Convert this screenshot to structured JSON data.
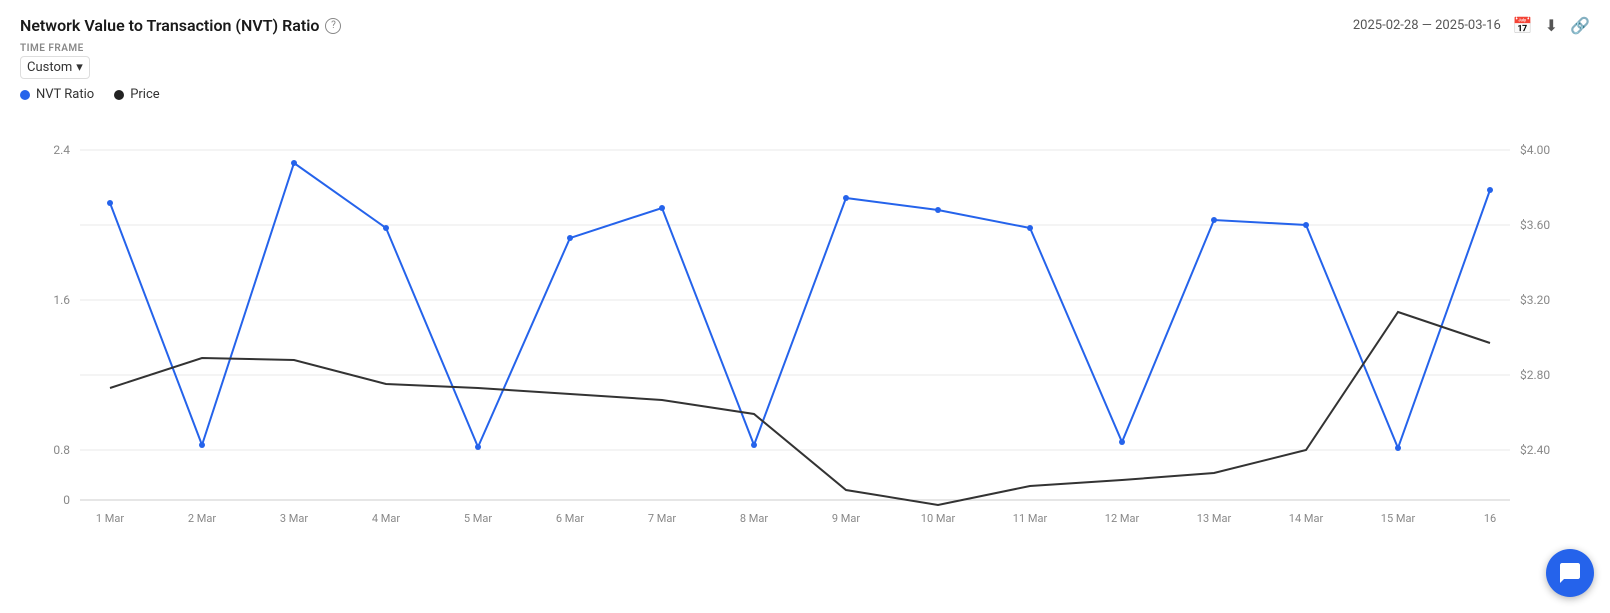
{
  "header": {
    "title": "Network Value to Transaction (NVT) Ratio",
    "help_icon": "?",
    "date_range": "2025-02-28  —  2025-03-16",
    "download_icon": "download",
    "link_icon": "link"
  },
  "timeframe": {
    "label": "TIME FRAME",
    "value": "Custom",
    "chevron": "▾"
  },
  "legend": [
    {
      "label": "NVT Ratio",
      "color": "#2563eb"
    },
    {
      "label": "Price",
      "color": "#222"
    }
  ],
  "chart": {
    "left_axis": [
      "0",
      "0.8",
      "1.6",
      "2.4"
    ],
    "right_axis": [
      "$2.4",
      "$2.80",
      "$3.20",
      "$3.60",
      "$4.00"
    ],
    "x_labels": [
      "1 Mar",
      "2 Mar",
      "3 Mar",
      "4 Mar",
      "5 Mar",
      "6 Mar",
      "7 Mar",
      "8 Mar",
      "9 Mar",
      "10 Mar",
      "11 Mar",
      "12 Mar",
      "13 Mar",
      "14 Mar",
      "15 Mar",
      "16"
    ]
  },
  "chat_button": {
    "label": "chat"
  }
}
